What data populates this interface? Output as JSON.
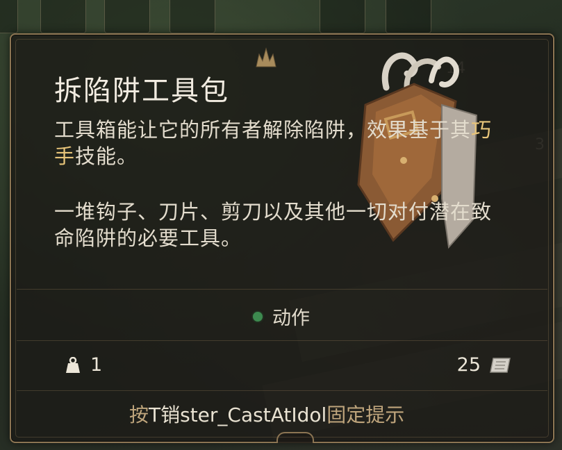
{
  "tooltip": {
    "title": "拆陷阱工具包",
    "description_pre": "工具箱能让它的所有者解除陷阱，效果基于其",
    "description_highlight": "巧手",
    "description_post": "技能。",
    "flavor": "一堆钩子、刀片、剪刀以及其他一切对付潜在致命陷阱的必要工具。",
    "action_label": "动作",
    "weight_value": "1",
    "gold_value": "25",
    "hint_prefix": "按",
    "hint_key": "T销ster_CastAtIdol",
    "hint_suffix": "固定提示",
    "icons": {
      "crest": "crest-icon",
      "item": "thieves-tools-icon",
      "weight": "weight-icon",
      "gold": "gold-icon",
      "action": "action-dot-icon"
    },
    "colors": {
      "highlight": "#e8c57a",
      "action_dot": "#3d8a4f",
      "border": "#8c7553",
      "hint": "#bfa57c"
    }
  },
  "background": {
    "slot_numbers": [
      "14",
      "3"
    ]
  }
}
